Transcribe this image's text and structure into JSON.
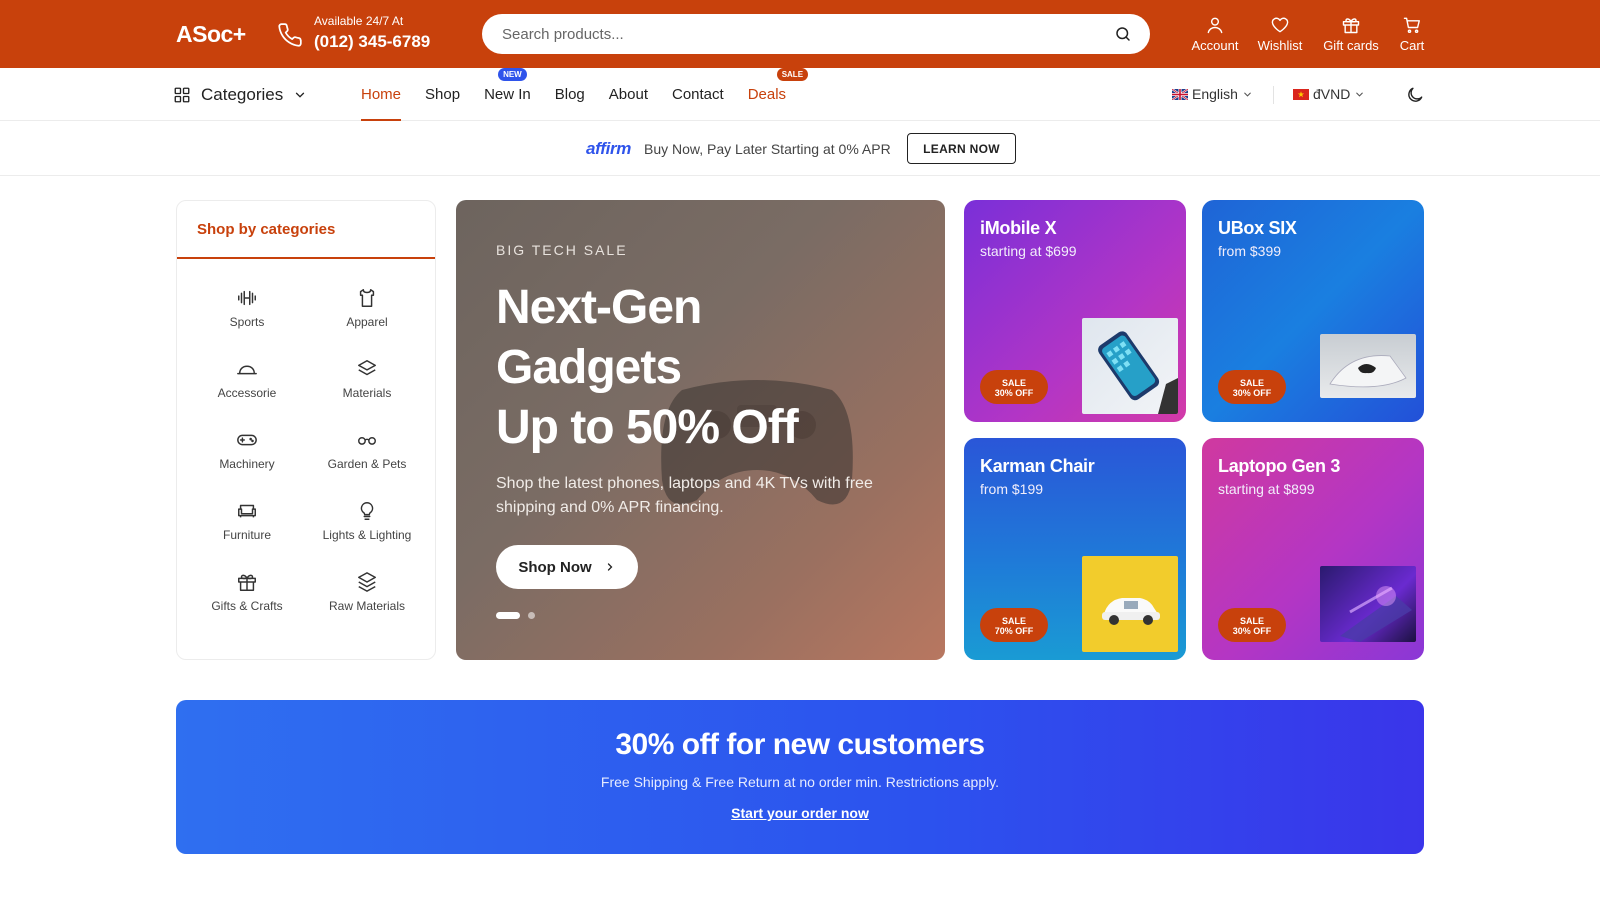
{
  "header": {
    "logo": "ASoc+",
    "availability": "Available 24/7 At",
    "phone": "(012) 345-6789",
    "search": {
      "placeholder": "Search products..."
    },
    "actions": [
      {
        "label": "Account",
        "icon": "user-icon"
      },
      {
        "label": "Wishlist",
        "icon": "heart-icon"
      },
      {
        "label": "Gift cards",
        "icon": "gift-icon"
      },
      {
        "label": "Cart",
        "icon": "cart-icon"
      }
    ],
    "brand_color": "#c8410c"
  },
  "nav": {
    "categories_label": "Categories",
    "menu": [
      {
        "label": "Home",
        "active": true
      },
      {
        "label": "Shop"
      },
      {
        "label": "New In",
        "badge": "NEW"
      },
      {
        "label": "Blog"
      },
      {
        "label": "About"
      },
      {
        "label": "Contact"
      },
      {
        "label": "Deals",
        "badge": "SALE"
      }
    ],
    "language": "English",
    "currency": "đVND"
  },
  "affirm": {
    "logo": "affirm",
    "text": "Buy Now, Pay Later Starting at 0% APR",
    "button": "LEARN NOW"
  },
  "sidebar": {
    "title": "Shop by categories",
    "items": [
      {
        "label": "Sports",
        "icon": "dumbbell-icon"
      },
      {
        "label": "Apparel",
        "icon": "shirt-icon"
      },
      {
        "label": "Accessorie",
        "icon": "hat-icon"
      },
      {
        "label": "Materials",
        "icon": "layers-icon"
      },
      {
        "label": "Machinery",
        "icon": "gamepad-icon"
      },
      {
        "label": "Garden & Pets",
        "icon": "glasses-icon"
      },
      {
        "label": "Furniture",
        "icon": "sofa-icon"
      },
      {
        "label": "Lights & Lighting",
        "icon": "lightbulb-icon"
      },
      {
        "label": "Gifts & Crafts",
        "icon": "gift-icon"
      },
      {
        "label": "Raw Materials",
        "icon": "layers-icon"
      }
    ]
  },
  "hero": {
    "kicker": "BIG TECH SALE",
    "title_line1": "Next-Gen",
    "title_line2": "Gadgets",
    "title_line3": "Up to 50% Off",
    "description": "Shop the latest phones, laptops and 4K TVs with free shipping and 0% APR financing.",
    "button": "Shop Now",
    "slides": 2,
    "active_slide": 1
  },
  "cards": [
    {
      "title": "iMobile X",
      "subtitle": "starting at $699",
      "sale_top": "SALE",
      "sale_bottom": "30% OFF",
      "image": "phone-image"
    },
    {
      "title": "UBox SIX",
      "subtitle": "from $399",
      "sale_top": "SALE",
      "sale_bottom": "30% OFF",
      "image": "console-image"
    },
    {
      "title": "Karman Chair",
      "subtitle": "from $199",
      "sale_top": "SALE",
      "sale_bottom": "70% OFF",
      "image": "toy-car-image"
    },
    {
      "title": "Laptopo Gen 3",
      "subtitle": "starting at $899",
      "sale_top": "SALE",
      "sale_bottom": "30% OFF",
      "image": "laptop-image"
    }
  ],
  "promo": {
    "title": "30% off for new customers",
    "subtitle": "Free Shipping & Free Return at no order min. Restrictions apply.",
    "link": "Start your order now"
  }
}
